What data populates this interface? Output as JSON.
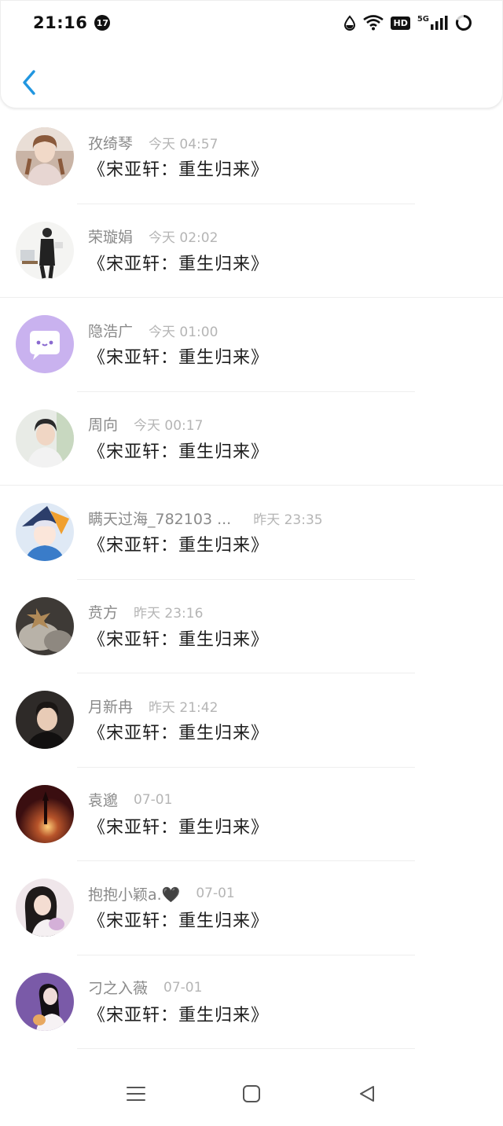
{
  "status_bar": {
    "time": "21:16",
    "notification_count": "17",
    "network_label": "HD",
    "signal_label": "5G"
  },
  "messages": [
    {
      "name": "孜绮琴",
      "time": "今天 04:57",
      "content": "《宋亚轩：重生归来》"
    },
    {
      "name": "荣璇娟",
      "time": "今天 02:02",
      "content": "《宋亚轩：重生归来》"
    },
    {
      "name": "隐浩广",
      "time": "今天 01:00",
      "content": "《宋亚轩：重生归来》"
    },
    {
      "name": "周向",
      "time": "今天 00:17",
      "content": "《宋亚轩：重生归来》"
    },
    {
      "name": "瞒天过海_782103 ...",
      "time": "昨天 23:35",
      "content": "《宋亚轩：重生归来》"
    },
    {
      "name": "贲方",
      "time": "昨天 23:16",
      "content": "《宋亚轩：重生归来》"
    },
    {
      "name": "月新冉",
      "time": "昨天 21:42",
      "content": "《宋亚轩：重生归来》"
    },
    {
      "name": "袁邈",
      "time": "07-01",
      "content": "《宋亚轩：重生归来》"
    },
    {
      "name": "抱抱小颖a.🖤",
      "time": "07-01",
      "content": "《宋亚轩：重生归来》"
    },
    {
      "name": "刁之入薇",
      "time": "07-01",
      "content": "《宋亚轩：重生归来》"
    }
  ],
  "colors": {
    "accent": "#2196e0",
    "name": "#8a8a8a",
    "timestamp": "#b5b5b5",
    "content": "#1e1e1e"
  }
}
